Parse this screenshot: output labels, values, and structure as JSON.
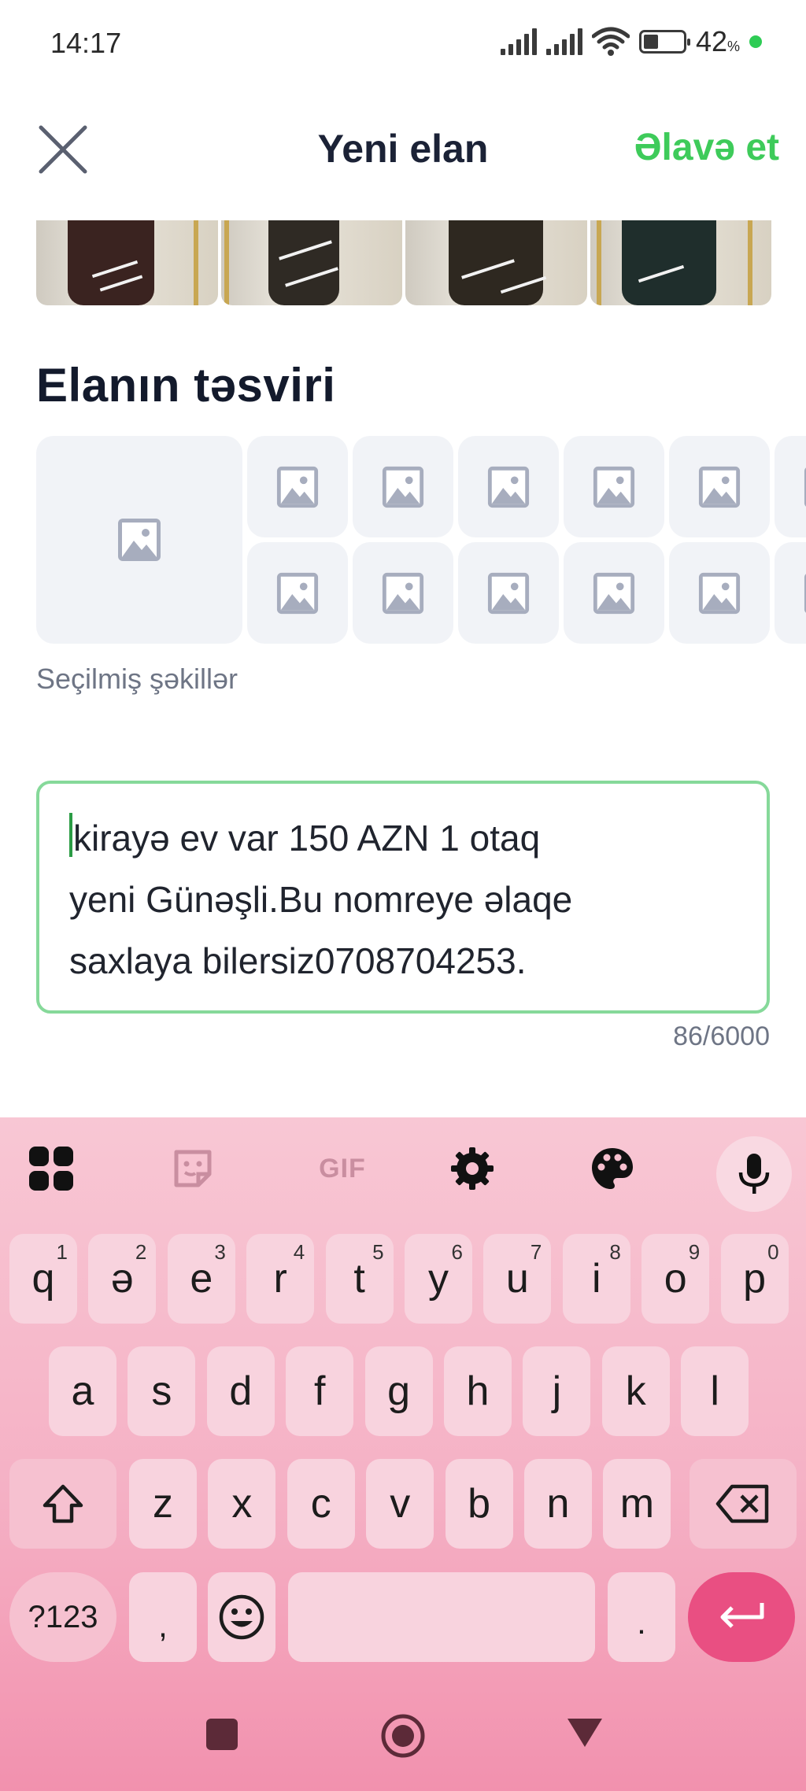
{
  "status_bar": {
    "time": "14:17",
    "battery_percent": "42",
    "battery_unit": "%",
    "battery_level": 0.42,
    "status_dot_color": "#2ecc55"
  },
  "header": {
    "title": "Yeni elan",
    "add_label": "Əlavə et",
    "close_icon": "close-icon",
    "accent_color": "#3ecb5a"
  },
  "photos": [
    {
      "name": "photo-1"
    },
    {
      "name": "photo-2"
    },
    {
      "name": "photo-3"
    },
    {
      "name": "photo-4"
    }
  ],
  "description_section": {
    "title": "Elanın təsviri",
    "selected_label": "Seçilmiş şəkillər",
    "text": "kirayə ev var 150 AZN 1 otaq\nyeni Günəşli.Bu nomreye əlaqe\nsaxlaya bilersiz0708704253.",
    "counter": "86/6000",
    "border_color": "#86d99a"
  },
  "keyboard": {
    "toolbar": [
      "apps-grid-icon",
      "sticker-icon",
      "GIF",
      "settings-gear-icon",
      "theme-palette-icon",
      "microphone-icon"
    ],
    "row1": [
      {
        "label": "q",
        "hint": "1"
      },
      {
        "label": "ə",
        "hint": "2"
      },
      {
        "label": "e",
        "hint": "3"
      },
      {
        "label": "r",
        "hint": "4"
      },
      {
        "label": "t",
        "hint": "5"
      },
      {
        "label": "y",
        "hint": "6"
      },
      {
        "label": "u",
        "hint": "7"
      },
      {
        "label": "i",
        "hint": "8"
      },
      {
        "label": "o",
        "hint": "9"
      },
      {
        "label": "p",
        "hint": "0"
      }
    ],
    "row2": [
      "a",
      "s",
      "d",
      "f",
      "g",
      "h",
      "j",
      "k",
      "l"
    ],
    "row3": [
      "z",
      "x",
      "c",
      "v",
      "b",
      "n",
      "m"
    ],
    "symbols_label": "?123",
    "comma_label": ",",
    "period_label": ".",
    "enter_color": "#e94f82"
  },
  "navigation": [
    "recent-apps-square-icon",
    "home-circle-icon",
    "back-triangle-icon"
  ]
}
